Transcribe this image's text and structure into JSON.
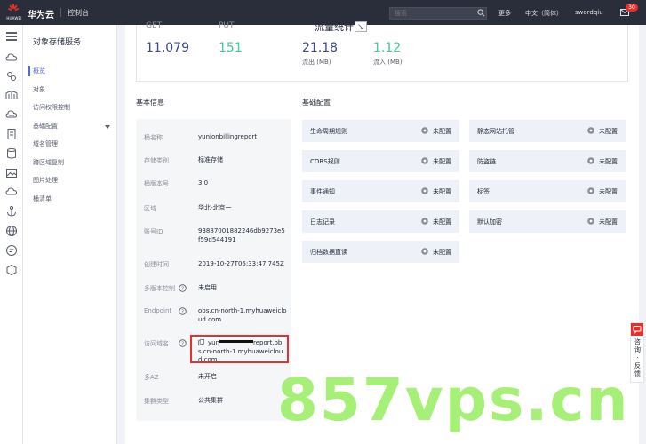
{
  "topbar": {
    "logo_text": "HUAWEI",
    "brand": "华为云",
    "console": "控制台",
    "search_placeholder": "搜索",
    "more": "更多",
    "language": "中文（简体）",
    "user": "swordqiu",
    "badge": "30"
  },
  "sidebar": {
    "title": "对象存储服务",
    "items": [
      {
        "label": "概览"
      },
      {
        "label": "对象"
      },
      {
        "label": "访问权限控制"
      },
      {
        "label": "基础配置"
      },
      {
        "label": "域名管理"
      },
      {
        "label": "跨区域复制"
      },
      {
        "label": "图片处理"
      },
      {
        "label": "桶清单"
      }
    ]
  },
  "stats": {
    "get_label": "GET",
    "get_value": "11,079",
    "put_label": "PUT",
    "put_value": "151",
    "flow_title": "流量统计",
    "out_value": "21.18",
    "out_unit": "流出 (MB)",
    "in_value": "1.12",
    "in_unit": "流入 (MB)"
  },
  "basic": {
    "title": "基本信息",
    "rows": [
      {
        "label": "桶名称",
        "value": "yunionbillingreport"
      },
      {
        "label": "存储类别",
        "value": "标准存储"
      },
      {
        "label": "桶版本号",
        "value": "3.0"
      },
      {
        "label": "区域",
        "value": "华北-北京一"
      },
      {
        "label": "账号ID",
        "value": "93887001882246db9273e5f59d544191"
      },
      {
        "label": "创建时间",
        "value": "2019-10-27T06:33:47.745Z"
      },
      {
        "label": "多版本控制",
        "value": "未启用"
      },
      {
        "label": "Endpoint",
        "value": "obs.cn-north-1.myhuaweicloud.com"
      },
      {
        "label": "访问域名",
        "value_prefix": "yun",
        "value_suffix": "report.obs.cn-north-1.myhuaweicloud.com"
      },
      {
        "label": "多AZ",
        "value": "未开启"
      },
      {
        "label": "集群类型",
        "value": "公共集群"
      }
    ]
  },
  "config": {
    "title": "基础配置",
    "items": [
      {
        "label": "生命周期规则",
        "status": "未配置"
      },
      {
        "label": "静态网站托管",
        "status": "未配置"
      },
      {
        "label": "CORS规则",
        "status": "未配置"
      },
      {
        "label": "防盗链",
        "status": "未配置"
      },
      {
        "label": "事件通知",
        "status": "未配置"
      },
      {
        "label": "标签",
        "status": "未配置"
      },
      {
        "label": "日志记录",
        "status": "未配置"
      },
      {
        "label": "默认加密",
        "status": "未配置"
      },
      {
        "label": "归档数据直读",
        "status": "未配置"
      }
    ]
  },
  "feedback": {
    "label": "咨询·反馈"
  },
  "watermark": "857vps.cn",
  "colors": {
    "accent": "#526ecc",
    "get": "#3a4a8a",
    "put": "#41c9a0",
    "highlight": "#e6302b",
    "watermark": "#9fef6c"
  }
}
